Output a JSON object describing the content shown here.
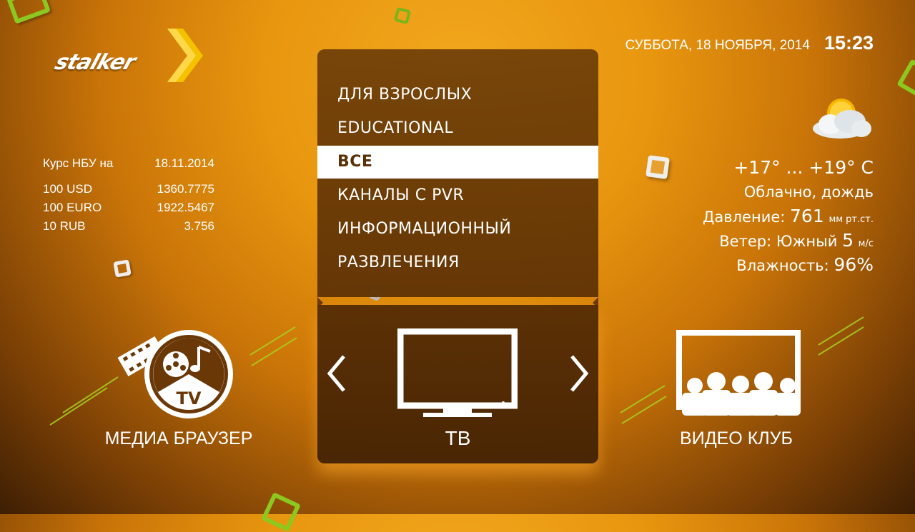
{
  "logo": {
    "text": "stalker"
  },
  "datetime": {
    "date": "СУББОТА, 18 НОЯБРЯ, 2014",
    "time": "15:23"
  },
  "currency": {
    "title": "Курс НБУ на",
    "date": "18.11.2014",
    "rows": [
      {
        "label": "100 USD",
        "value": "1360.7775"
      },
      {
        "label": "100 EURO",
        "value": "1922.5467"
      },
      {
        "label": "10 RUB",
        "value": "3.756"
      }
    ]
  },
  "weather": {
    "icon": "cloud-rain-sun-icon",
    "temp": "+17° ... +19° C",
    "description": "Облачно, дождь",
    "pressure_label": "Давление:",
    "pressure_value": "761",
    "pressure_unit": "мм рт.ст.",
    "wind_label": "Ветер: Южный",
    "wind_value": "5",
    "wind_unit": "м/с",
    "humidity_label": "Влажность:",
    "humidity_value": "96%"
  },
  "menu": {
    "items": [
      {
        "label": "ДЛЯ ВЗРОСЛЫХ",
        "selected": false
      },
      {
        "label": "EDUCATIONAL",
        "selected": false
      },
      {
        "label": "ВСЕ",
        "selected": true
      },
      {
        "label": "КАНАЛЫ С PVR",
        "selected": false
      },
      {
        "label": "ИНФОРМАЦИОННЫЙ",
        "selected": false
      },
      {
        "label": "РАЗВЛЕЧЕНИЯ",
        "selected": false
      }
    ]
  },
  "carousel": {
    "left": {
      "label": "МЕДИА БРАУЗЕР",
      "icon": "media-browser-icon"
    },
    "center": {
      "label": "ТВ",
      "icon": "tv-icon"
    },
    "right": {
      "label": "ВИДЕО КЛУБ",
      "icon": "video-club-icon"
    }
  },
  "colors": {
    "accent": "#f2a81e",
    "panel": "#5f3205",
    "selected_bg": "#ffffff",
    "selected_text": "#5a3208",
    "lime": "#a8d21e"
  }
}
